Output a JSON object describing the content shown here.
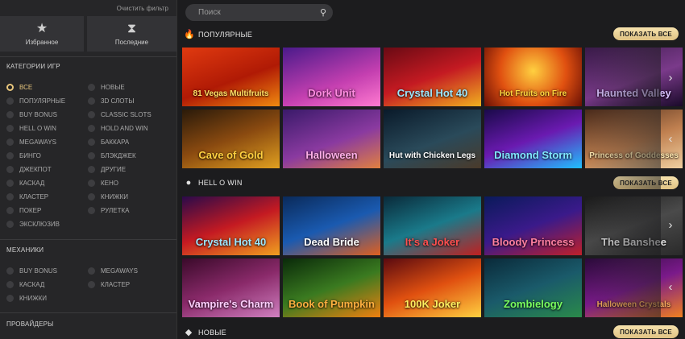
{
  "sidebar": {
    "clear_filter": "Очистить фильтр",
    "favorites_label": "Избранное",
    "recent_label": "Последние",
    "categories_title": "КАТЕГОРИИ ИГР",
    "categories_left": [
      "ВСЕ",
      "ПОПУЛЯРНЫЕ",
      "BUY BONUS",
      "HELL O WIN",
      "MEGAWAYS",
      "БИНГО",
      "ДЖЕКПОТ",
      "КАСКАД",
      "КЛАСТЕР",
      "ПОКЕР",
      "ЭКСКЛЮЗИВ"
    ],
    "categories_right": [
      "НОВЫЕ",
      "3D СЛОТЫ",
      "CLASSIC SLOTS",
      "HOLD AND WIN",
      "БАККАРА",
      "БЛЭКДЖЕК",
      "ДРУГИЕ",
      "КЕНО",
      "КНИЖКИ",
      "РУЛЕТКА"
    ],
    "mechanics_title": "МЕХАНИКИ",
    "mechanics_left": [
      "BUY BONUS",
      "КАСКАД",
      "КНИЖКИ"
    ],
    "mechanics_right": [
      "MEGAWAYS",
      "КЛАСТЕР"
    ],
    "providers_title": "ПРОВАЙДЕРЫ"
  },
  "search": {
    "placeholder": "Поиск"
  },
  "sections": [
    {
      "title": "ПОПУЛЯРНЫЕ",
      "show_all": "ПОКАЗАТЬ ВСЕ",
      "icon": "flame-icon"
    },
    {
      "title": "HELL O WIN",
      "show_all": "ПОКАЗАТЬ ВСЕ",
      "icon": "pumpkin-icon"
    },
    {
      "title": "НОВЫЕ",
      "show_all": "ПОКАЗАТЬ ВСЕ",
      "icon": "diamond-icon"
    }
  ],
  "popular_games": [
    "81 Vegas Multifruits",
    "Dork Unit",
    "Crystal Hot 40",
    "Hot Fruits on Fire",
    "Haunted Valley",
    "Cave of Gold",
    "Halloween",
    "Hut with Chicken Legs",
    "Diamond Storm",
    "Princess of Goddesses"
  ],
  "halloween_games": [
    "Crystal Hot 40",
    "Dead Bride",
    "It's a Joker",
    "Bloody Princess",
    "The Banshee",
    "Vampire's Charm",
    "Book of Pumpkin",
    "100K Joker",
    "Zombielogy",
    "Halloween Crystals"
  ],
  "colors": {
    "accent": "#e9c77d",
    "background": "#1c1c1e",
    "sidebar": "#262628"
  }
}
